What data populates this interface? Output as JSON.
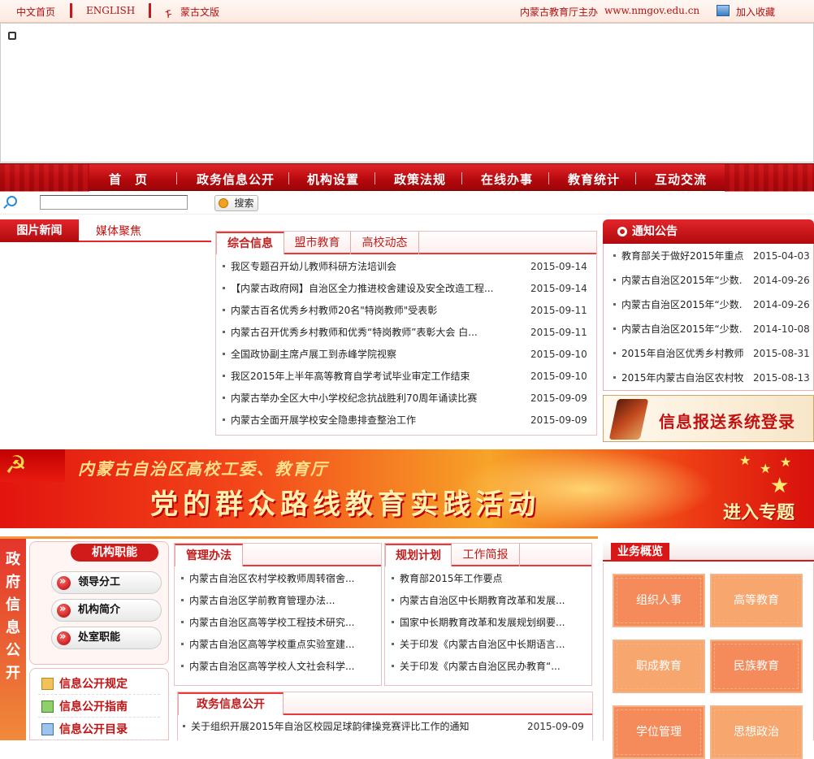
{
  "topbar": {
    "home_cn": "中文首页",
    "english": "ENGLISH",
    "mongolian": "蒙古文版",
    "host": "内蒙古教育厅主办",
    "site": "www.nmgov.edu.cn",
    "bookmark": "加入收藏"
  },
  "nav": {
    "items": [
      "首　页",
      "政务信息公开",
      "机构设置",
      "政策法规",
      "在线办事",
      "教育统计",
      "互动交流"
    ]
  },
  "search": {
    "button": "搜索",
    "value": ""
  },
  "photo_news": {
    "tabs": [
      "图片新闻",
      "媒体聚焦"
    ]
  },
  "news": {
    "tabs": [
      "综合信息",
      "盟市教育",
      "高校动态"
    ],
    "rows": [
      {
        "title": "我区专题召开幼儿教师科研方法培训会",
        "date": "2015-09-14"
      },
      {
        "title": "【内蒙古政府网】自治区全力推进校舍建设及安全改造工程...",
        "date": "2015-09-14"
      },
      {
        "title": "内蒙古百名优秀乡村教师20名\"特岗教师\"受表彰",
        "date": "2015-09-11"
      },
      {
        "title": "内蒙古召开优秀乡村教师和优秀“特岗教师”表彰大会 白...",
        "date": "2015-09-11"
      },
      {
        "title": "全国政协副主席卢展工到赤峰学院视察",
        "date": "2015-09-10"
      },
      {
        "title": "我区2015年上半年高等教育自学考试毕业审定工作结束",
        "date": "2015-09-10"
      },
      {
        "title": "内蒙古举办全区大中小学校纪念抗战胜利70周年诵读比赛",
        "date": "2015-09-09"
      },
      {
        "title": "内蒙古全面开展学校安全隐患排查整治工作",
        "date": "2015-09-09"
      }
    ]
  },
  "notice": {
    "title": "通知公告",
    "rows": [
      {
        "title": "教育部关于做好2015年重点...",
        "date": "2015-04-03"
      },
      {
        "title": "内蒙古自治区2015年“少数...",
        "date": "2014-09-26"
      },
      {
        "title": "内蒙古自治区2015年“少数...",
        "date": "2014-09-26"
      },
      {
        "title": "内蒙古自治区2015年“少数...",
        "date": "2014-10-08"
      },
      {
        "title": "2015年自治区优秀乡村教师...",
        "date": "2015-08-31"
      },
      {
        "title": "2015年内蒙古自治区农村牧...",
        "date": "2015-08-13"
      }
    ]
  },
  "report_login": "信息报送系统登录",
  "banner": {
    "line1": "内蒙古自治区高校工委、教育厅",
    "line2": "党的群众路线教育实践活动",
    "enter": "进入专题"
  },
  "gov_info": {
    "vertical_label": [
      "政",
      "府",
      "信",
      "息",
      "公",
      "开"
    ],
    "org_duty": {
      "title": "机构职能",
      "buttons": [
        "领导分工",
        "机构简介",
        "处室职能"
      ]
    },
    "open_links": [
      "信息公开规定",
      "信息公开指南",
      "信息公开目录"
    ]
  },
  "management": {
    "tab": "管理办法",
    "rows": [
      "内蒙古自治区农村学校教师周转宿舍...",
      "内蒙古自治区学前教育管理办法...",
      "内蒙古自治区高等学校工程技术研究...",
      "内蒙古自治区高等学校重点实验室建...",
      "内蒙古自治区高等学校人文社会科学..."
    ]
  },
  "planning": {
    "tabs": [
      "规划计划",
      "工作简报"
    ],
    "rows": [
      "教育部2015年工作要点",
      "内蒙古自治区中长期教育改革和发展...",
      "国家中长期教育改革和发展规划纲要...",
      "关于印发《内蒙古自治区中长期语言...",
      "关于印发《内蒙古自治区民办教育“..."
    ]
  },
  "gov_open": {
    "tab": "政务信息公开",
    "rows": [
      {
        "title": "关于组织开展2015年自治区校园足球韵律操竞赛评比工作的通知",
        "date": "2015-09-09"
      }
    ]
  },
  "business": {
    "title": "业务概览",
    "tiles": [
      "组织人事",
      "高等教育",
      "职成教育",
      "民族教育",
      "学位管理",
      "思想政治"
    ]
  },
  "colors": {
    "brand_red": "#c8181a",
    "tile_orange": "#f58a5a",
    "tile_light": "#f7a66e"
  }
}
